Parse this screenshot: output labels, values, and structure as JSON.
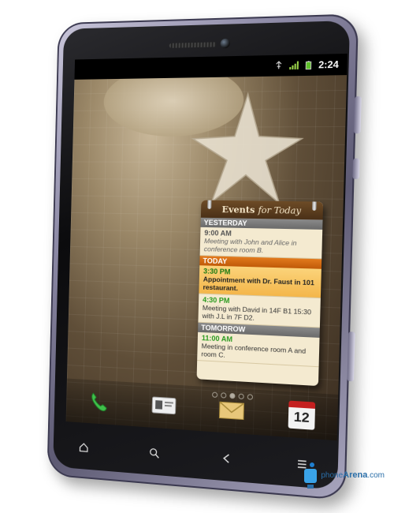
{
  "status_bar": {
    "time": "2:24",
    "icons": [
      "usb-icon",
      "signal-icon",
      "battery-icon"
    ]
  },
  "widget": {
    "title_bold": "Events",
    "title_rest": "for Today",
    "sections": [
      {
        "label": "YESTERDAY",
        "events": [
          {
            "time": "9:00 AM",
            "desc": "Meeting with John and Alice in conference room B."
          }
        ]
      },
      {
        "label": "TODAY",
        "events": [
          {
            "time": "3:30 PM",
            "desc": "Appointment with Dr. Faust in 101 restaurant."
          },
          {
            "time": "4:30 PM",
            "desc": "Meeting with David in 14F B1 15:30 with J.L in 7F D2."
          }
        ]
      },
      {
        "label": "TOMORROW",
        "events": [
          {
            "time": "11:00 AM",
            "desc": "Meeting in conference room A and room C."
          }
        ]
      }
    ]
  },
  "page_indicator": {
    "total": 5,
    "active": 3
  },
  "dock": {
    "icons": [
      "phone-icon",
      "contacts-icon",
      "email-icon",
      "calendar-icon"
    ],
    "calendar_day": "12"
  },
  "softkeys": [
    "home-icon",
    "search-icon",
    "back-icon",
    "menu-icon"
  ],
  "watermark": {
    "brand": "phone",
    "brand_bold": "Arena",
    "suffix": ".com"
  },
  "colors": {
    "today_header": "#e27a1d",
    "past_header": "#7a7a7a",
    "event_time_green": "#2a9a1f",
    "widget_bg": "#f4ead0"
  }
}
